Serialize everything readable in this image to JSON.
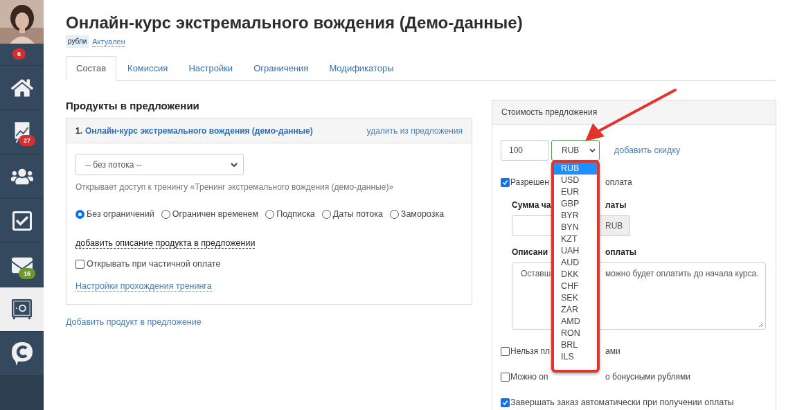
{
  "sidebar": {
    "items": [
      {
        "kind": "avatar",
        "badge": "6",
        "color": "#d32f2f",
        "selected": false
      },
      {
        "kind": "home",
        "selected": false
      },
      {
        "kind": "chart",
        "badge": "27",
        "color": "#d32f2f",
        "selected": false
      },
      {
        "kind": "users",
        "selected": false
      },
      {
        "kind": "tasks",
        "selected": false
      },
      {
        "kind": "mail",
        "badge": "16",
        "color": "#6a9a2e",
        "selected": false
      },
      {
        "kind": "safe",
        "selected": true
      },
      {
        "kind": "chat",
        "selected": false
      }
    ]
  },
  "title": "Онлайн-курс экстремального вождения (Демо-данные)",
  "currency_tag": "рубли",
  "status_link": "Актуален",
  "tabs": [
    {
      "label": "Состав",
      "selected": true
    },
    {
      "label": "Комиссия",
      "selected": false
    },
    {
      "label": "Настройки",
      "selected": false
    },
    {
      "label": "Ограничения",
      "selected": false
    },
    {
      "label": "Модификаторы",
      "selected": false
    }
  ],
  "products_title": "Продукты в предложении",
  "product": {
    "number": "1.",
    "name": "Онлайн-курс экстремального вождения (демо-данные)",
    "remove_link": "удалить из предложения",
    "stream_select": "-- без потока --",
    "access_note": "Открывает доступ к тренингу «Тренинг экстремального вождения (демо-данные)»",
    "access_options": [
      {
        "label": "Без ограничений",
        "selected": true
      },
      {
        "label": "Ограничен временем",
        "selected": false
      },
      {
        "label": "Подписка",
        "selected": false
      },
      {
        "label": "Даты потока",
        "selected": false
      },
      {
        "label": "Заморозка",
        "selected": false
      }
    ],
    "description_link": "добавить описание продукта в предложении",
    "partial_open": {
      "label": "Открывать при частичной оплате",
      "checked": false
    },
    "settings_link": "Настройки прохождения тренинга"
  },
  "add_product_link": "Добавить продукт в предложение",
  "price": {
    "title": "Стоимость предложения",
    "amount": "100",
    "currency": "RUB",
    "discount_link": "добавить скидку",
    "currency_options": [
      {
        "label": "RUB",
        "selected": true
      },
      {
        "label": "USD",
        "selected": false
      },
      {
        "label": "EUR",
        "selected": false
      },
      {
        "label": "GBP",
        "selected": false
      },
      {
        "label": "BYR",
        "selected": false
      },
      {
        "label": "BYN",
        "selected": false
      },
      {
        "label": "KZT",
        "selected": false
      },
      {
        "label": "UAH",
        "selected": false
      },
      {
        "label": "AUD",
        "selected": false
      },
      {
        "label": "DKK",
        "selected": false
      },
      {
        "label": "CHF",
        "selected": false
      },
      {
        "label": "SEK",
        "selected": false
      },
      {
        "label": "ZAR",
        "selected": false
      },
      {
        "label": "AMD",
        "selected": false
      },
      {
        "label": "RON",
        "selected": false
      },
      {
        "label": "BRL",
        "selected": false
      },
      {
        "label": "ILS",
        "selected": false
      }
    ],
    "partial_payment": {
      "checked": true,
      "label_start": "Разрешен",
      "label_end": "оплата"
    },
    "partial_sum": {
      "label_start": "Сумма ча",
      "label_end": "латы",
      "addon": "RUB"
    },
    "partial_desc": {
      "label_start": "Описани",
      "label_end": "оплаты",
      "text_start": "Оставш",
      "text_end": "можно будет оплатить до начала курса."
    },
    "options": [
      {
        "checked": false,
        "label_start": "Нельзя пл",
        "label_end": "ами"
      },
      {
        "checked": false,
        "label_start": "Можно оп",
        "label_end": "о бонусными рублями"
      },
      {
        "checked": true,
        "label": "Завершать заказ автоматически при получении оплаты"
      }
    ]
  }
}
